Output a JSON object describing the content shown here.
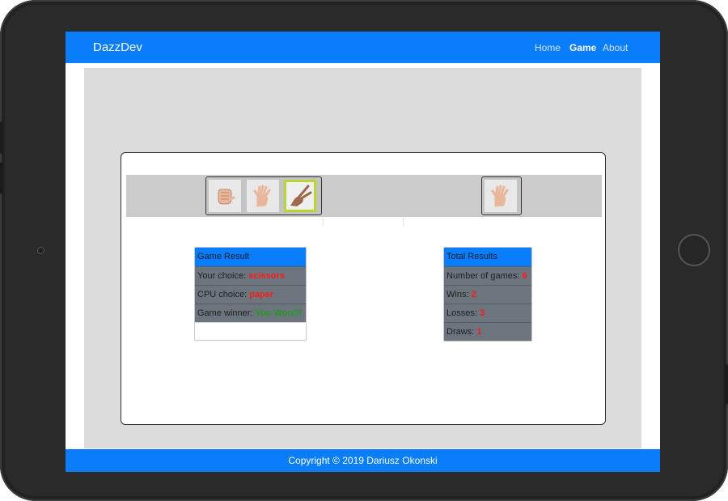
{
  "app": {
    "brand": "DazzDev"
  },
  "nav": {
    "home": "Home",
    "game": "Game",
    "about": "About"
  },
  "player": {
    "options": [
      {
        "name": "rock",
        "icon": "rock-hand-icon"
      },
      {
        "name": "paper",
        "icon": "paper-hand-icon"
      },
      {
        "name": "scissors",
        "icon": "scissors-hand-icon"
      }
    ],
    "selected": "scissors"
  },
  "cpu": {
    "icon": "paper-hand-icon",
    "choice": "paper"
  },
  "game_result": {
    "header": "Game Result",
    "your_choice_label": "Your choice: ",
    "your_choice_value": "scissors",
    "cpu_choice_label": "CPU choice: ",
    "cpu_choice_value": "paper",
    "winner_label": "Game winner: ",
    "winner_value": "You Won!!!"
  },
  "total_results": {
    "header": "Total Results",
    "games_label": "Number of games: ",
    "games_value": "6",
    "wins_label": "Wins: ",
    "wins_value": "2",
    "losses_label": "Losses: ",
    "losses_value": "3",
    "draws_label": "Draws: ",
    "draws_value": "1"
  },
  "footer": {
    "text": "Copyright © 2019 Dariusz Okonski"
  },
  "colors": {
    "primary": "#0a7dfb",
    "selected_border": "#b8d631",
    "result_body": "#6c757d",
    "value_red": "#ff1a1a",
    "value_green": "#1f9c1f"
  }
}
